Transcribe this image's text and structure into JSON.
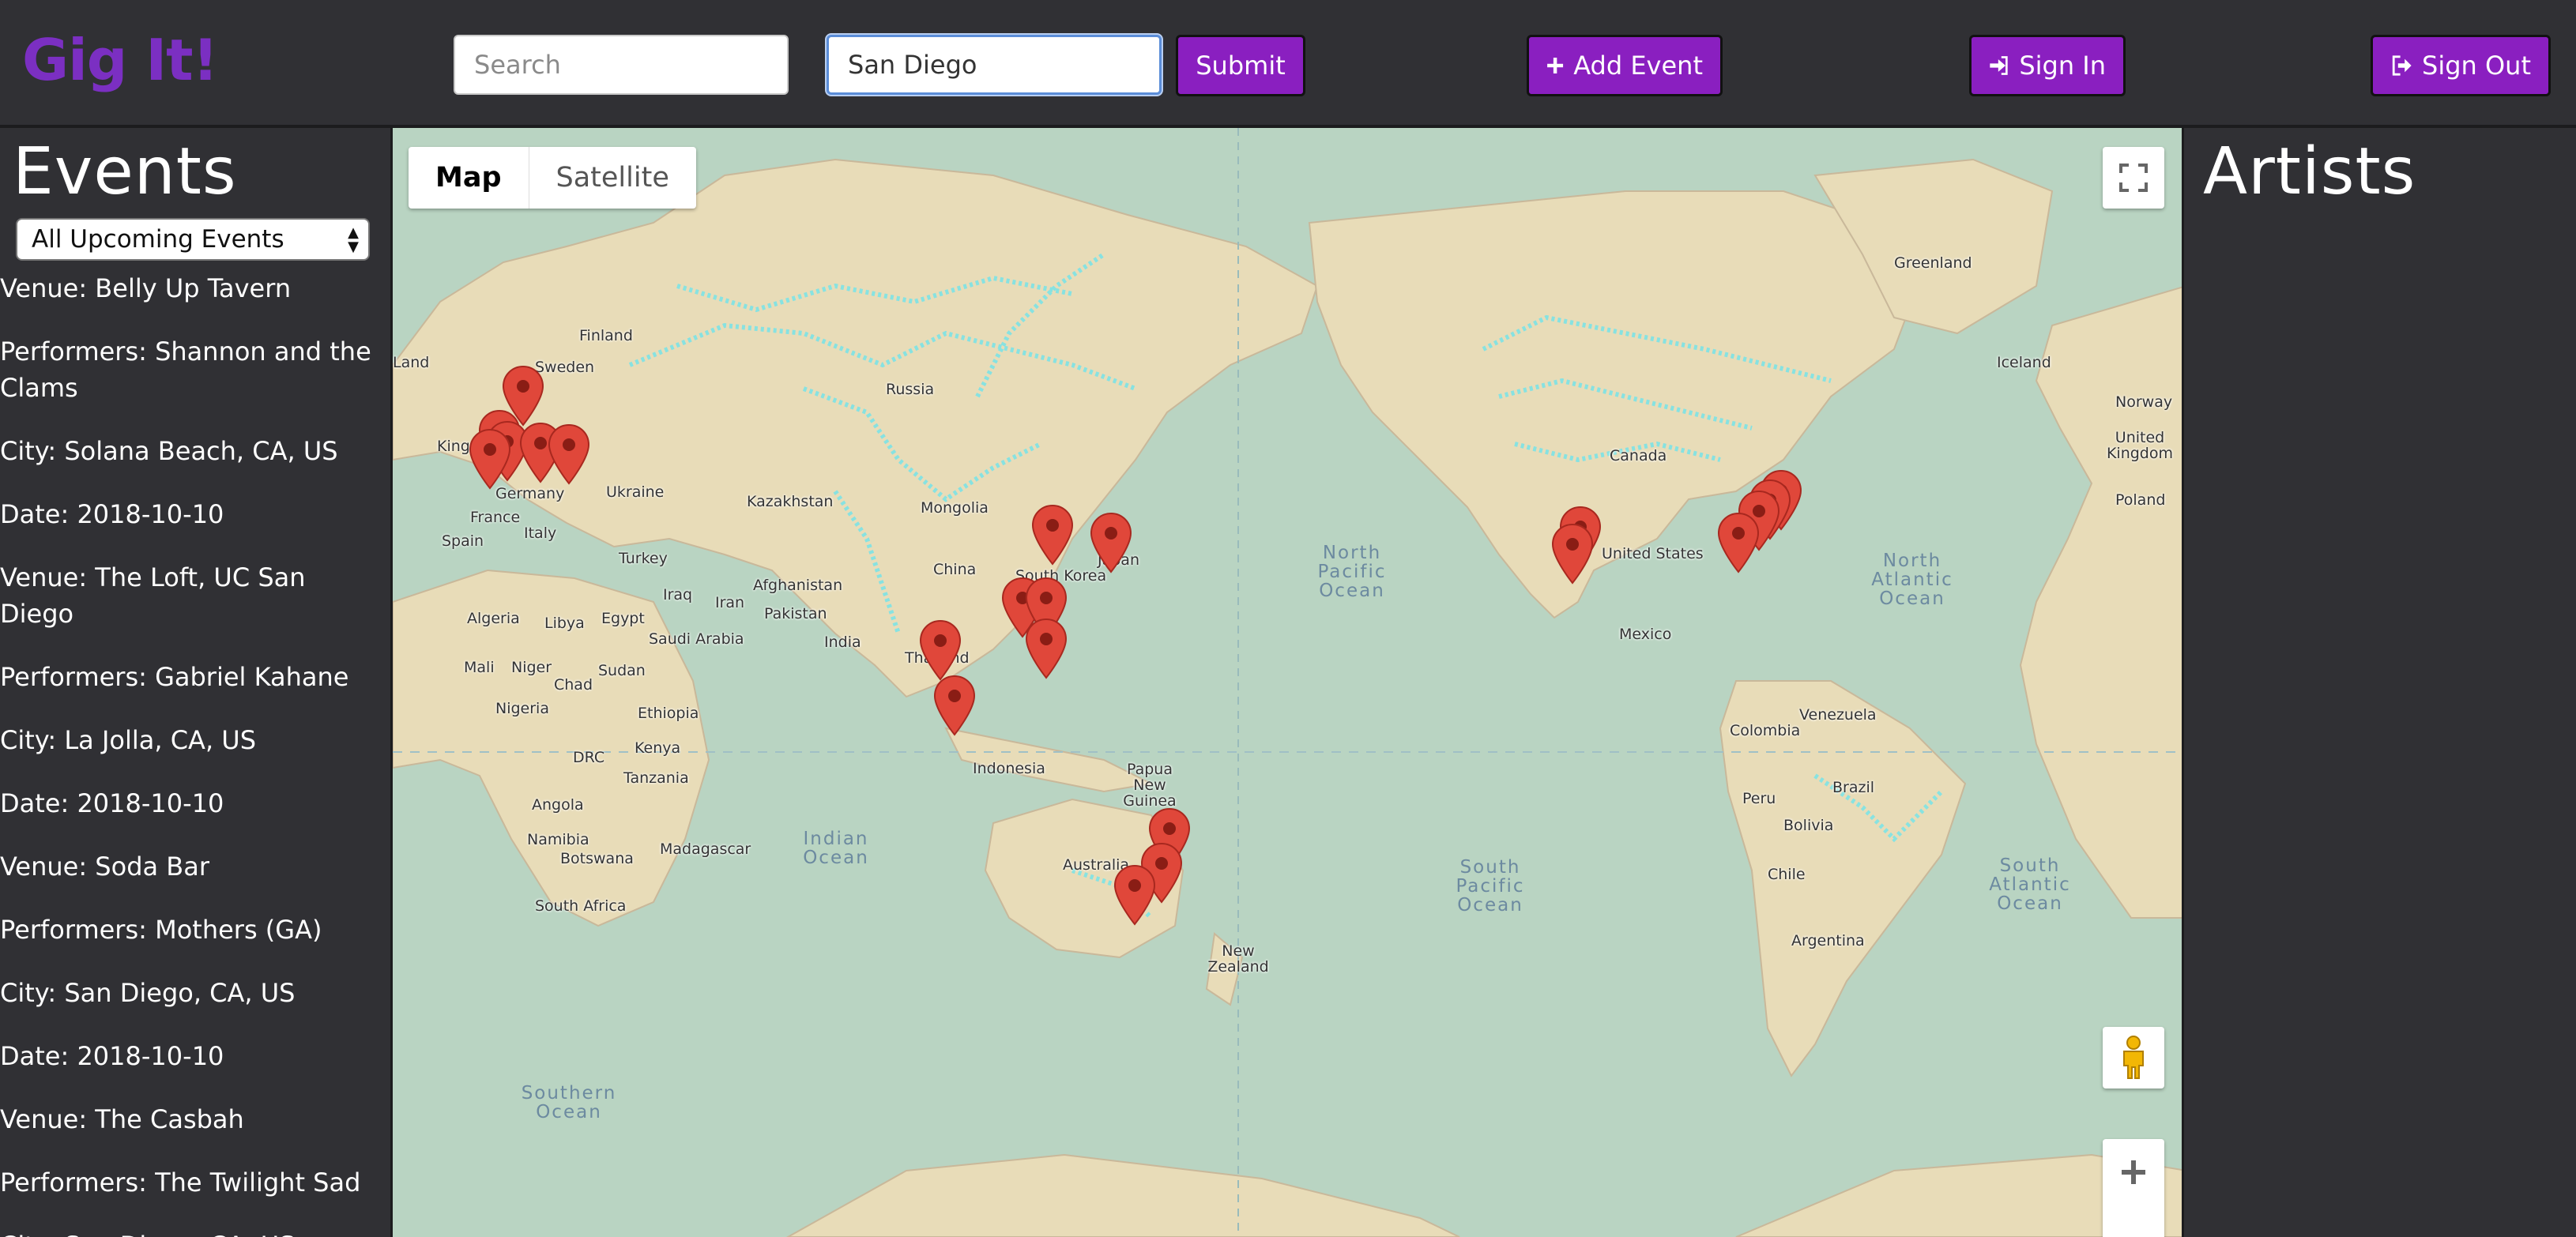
{
  "brand": "Gig It!",
  "nav": {
    "search_placeholder": "Search",
    "city_value": "San Diego",
    "submit_label": "Submit",
    "add_event_label": "Add Event",
    "sign_in_label": "Sign In",
    "sign_out_label": "Sign Out"
  },
  "sidebar": {
    "title": "Events",
    "filter_selected": "All Upcoming Events",
    "lines": [
      "Venue: Belly Up Tavern",
      "Performers: Shannon and the Clams",
      "City: Solana Beach, CA, US",
      "Date: 2018-10-10",
      "Venue: The Loft, UC San Diego",
      "Performers: Gabriel Kahane",
      "City: La Jolla, CA, US",
      "Date: 2018-10-10",
      "Venue: Soda Bar",
      "Performers: Mothers (GA)",
      "City: San Diego, CA, US",
      "Date: 2018-10-10",
      "Venue: The Casbah",
      "Performers: The Twilight Sad",
      "City: San Diego, CA, US"
    ]
  },
  "map": {
    "type_options": [
      "Map",
      "Satellite"
    ],
    "active_type": "Map",
    "labels": [
      "Finland",
      "Sweden",
      "Russia",
      "Ukraine",
      "Germany",
      "France",
      "Spain",
      "Italy",
      "Kingd",
      "Turkey",
      "Iraq",
      "Iran",
      "Afghanistan",
      "Pakistan",
      "India",
      "Kazakhstan",
      "Mongolia",
      "China",
      "South Korea",
      "Japan",
      "Thailand",
      "Indonesia",
      "Papua New Guinea",
      "Australia",
      "New Zealand",
      "Algeria",
      "Libya",
      "Egypt",
      "Saudi Arabia",
      "Mali",
      "Niger",
      "Chad",
      "Sudan",
      "Nigeria",
      "Ethiopia",
      "DRC",
      "Kenya",
      "Tanzania",
      "Angola",
      "Namibia",
      "Botswana",
      "Madagascar",
      "South Africa",
      "Canada",
      "United States",
      "Mexico",
      "Venezuela",
      "Colombia",
      "Peru",
      "Brazil",
      "Bolivia",
      "Chile",
      "Argentina",
      "Greenland",
      "Iceland",
      "Norway",
      "United Kingdom",
      "Poland",
      "Land"
    ],
    "oceans": [
      "North Pacific Ocean",
      "North Atlantic Ocean",
      "Indian Ocean",
      "South Pacific Ocean",
      "South Atlantic Ocean",
      "Southern Ocean"
    ]
  },
  "artists": {
    "title": "Artists"
  },
  "colors": {
    "brand": "#7b2fc2",
    "button": "#8a1fc0",
    "marker": "#e0473a",
    "land": "#e8dcb8",
    "water": "#b9d4c2",
    "roads": "#7de3e6"
  }
}
